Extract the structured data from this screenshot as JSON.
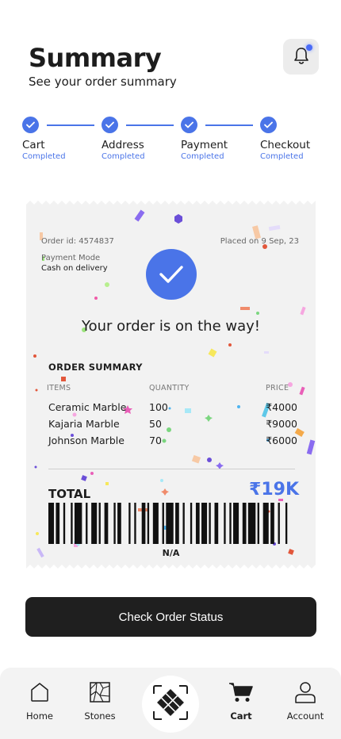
{
  "header": {
    "title": "Summary",
    "subtitle": "See your order summary"
  },
  "steps": [
    {
      "label": "Cart",
      "status": "Completed"
    },
    {
      "label": "Address",
      "status": "Completed"
    },
    {
      "label": "Payment",
      "status": "Completed"
    },
    {
      "label": "Checkout",
      "status": "Completed"
    }
  ],
  "receipt": {
    "order_id": "Order id: 4574837",
    "placed_on": "Placed on 9 Sep, 23",
    "payment_mode_label": "Payment Mode",
    "payment_mode_value": "Cash on delivery",
    "message": "Your order is on the way!",
    "summary_title": "ORDER SUMMARY",
    "columns": {
      "items": "ITEMS",
      "quantity": "QUANTITY",
      "price": "PRICE"
    },
    "rows": [
      {
        "item": "Ceramic Marble",
        "quantity": "100",
        "price": "₹4000"
      },
      {
        "item": "Kajaria Marble",
        "quantity": "50",
        "price": "₹9000"
      },
      {
        "item": "Johnson Marble",
        "quantity": "70",
        "price": "₹6000"
      }
    ],
    "total_label": "TOTAL",
    "total_value": "₹19K",
    "barcode_text": "N/A"
  },
  "cta": {
    "label": "Check Order Status"
  },
  "nav": {
    "home": "Home",
    "stones": "Stones",
    "cart": "Cart",
    "account": "Account"
  },
  "colors": {
    "accent": "#4a74e8",
    "cta_bg": "#1f1f1f",
    "receipt_bg": "#f2f2f2"
  }
}
